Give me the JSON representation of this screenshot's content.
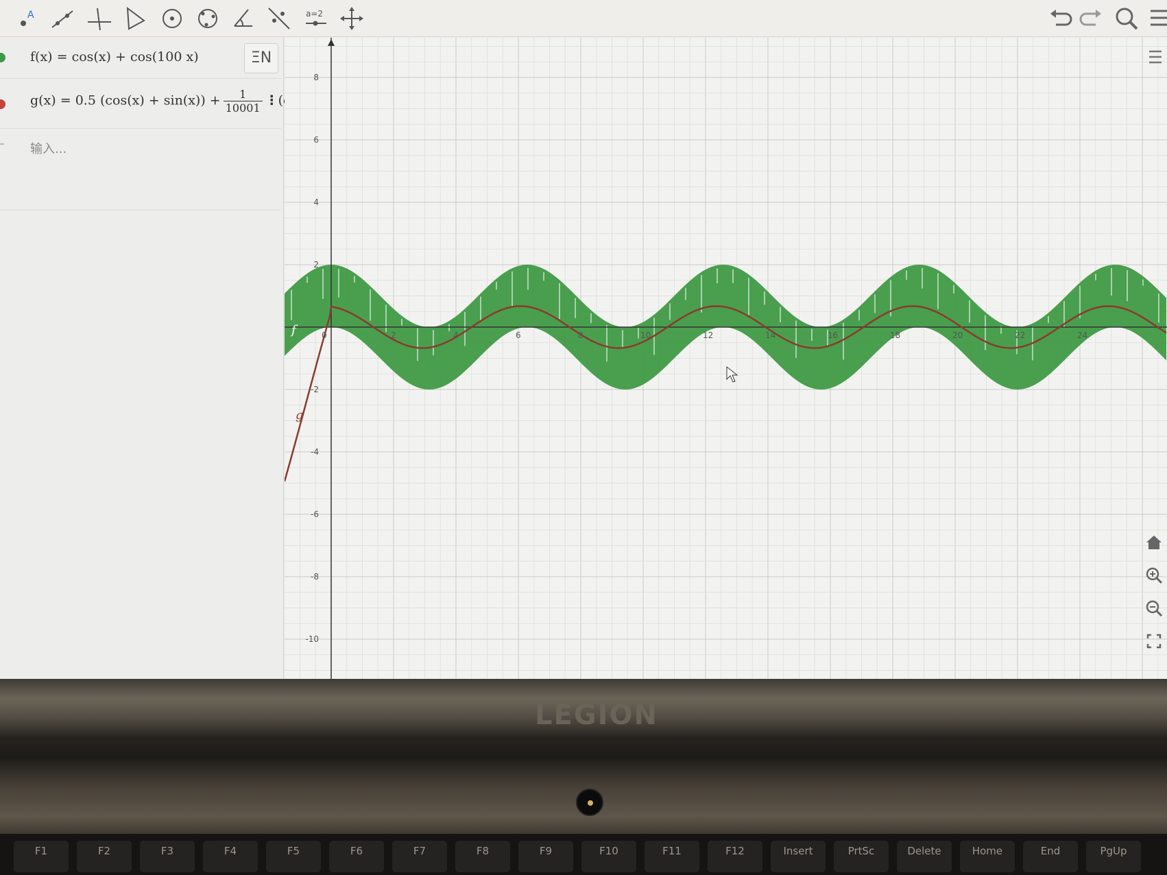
{
  "toolbar": {
    "left_tools": [
      "point-tool-icon",
      "line-tool-icon",
      "perpendicular-tool-icon",
      "polygon-tool-icon",
      "circle-center-tool-icon",
      "circle-three-points-tool-icon",
      "angle-tool-icon",
      "reflect-tool-icon",
      "slider-tool-icon",
      "move-view-tool-icon"
    ],
    "slider_label": "a=2",
    "right_tools": [
      "undo-icon",
      "redo-icon",
      "search-icon",
      "menu-icon"
    ]
  },
  "algebra": {
    "f_expr": "f(x) = cos(x) + cos(100 x)",
    "g_prefix": "g(x) = 0.5 (cos(x) + sin(x)) +",
    "g_frac_num": "1",
    "g_frac_den": "10001",
    "g_suffix": "(cos(",
    "g_dots": "⋮",
    "keyboard_toggle": "ΞN",
    "input_placeholder": "输入..."
  },
  "graphics": {
    "x_ticks": [
      "2",
      "4",
      "6",
      "8",
      "10",
      "12",
      "14",
      "16",
      "18",
      "20",
      "22",
      "24"
    ],
    "y_ticks": [
      "8",
      "6",
      "4",
      "2",
      "-2",
      "-4",
      "-6",
      "-8",
      "-10"
    ],
    "origin_label": "0",
    "f_label": "f",
    "g_label": "g",
    "colors": {
      "f": "#3f9a45",
      "g": "#8b3a2e",
      "grid_major": "#c9c9c6",
      "grid_minor": "#e1e1de",
      "axis": "#333333"
    }
  },
  "view_controls": [
    "home-icon",
    "zoom-in-icon",
    "zoom-out-icon",
    "fullscreen-icon"
  ],
  "laptop": {
    "brand": "LEGION",
    "fkeys": [
      "F1",
      "F2",
      "F3",
      "F4",
      "F5",
      "F6",
      "F7",
      "F8",
      "F9",
      "F10",
      "F11",
      "F12",
      "Insert",
      "PrtSc",
      "Delete",
      "Home",
      "End",
      "PgUp"
    ]
  }
}
